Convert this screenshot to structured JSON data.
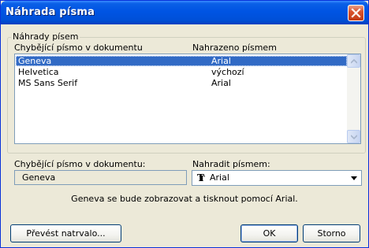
{
  "window": {
    "title": "Náhrada písma"
  },
  "group": {
    "label": "Náhrady písem"
  },
  "table": {
    "headers": [
      "Chybějící písmo v dokumentu",
      "Nahrazeno písmem"
    ],
    "rows": [
      {
        "missing": "Geneva",
        "replacement": "Arial",
        "selected": true
      },
      {
        "missing": "Helvetica",
        "replacement": "výchozí",
        "selected": false
      },
      {
        "missing": "MS Sans Serif",
        "replacement": "Arial",
        "selected": false
      }
    ]
  },
  "detail": {
    "missing_label": "Chybějící písmo v dokumentu:",
    "missing_value": "Geneva",
    "replace_label": "Nahradit písmem:",
    "replace_value": "Arial",
    "replace_icon": "truetype-icon",
    "status": "Geneva se bude zobrazovat a tisknout pomocí Arial."
  },
  "buttons": {
    "convert": "Převést natrvalo...",
    "ok": "OK",
    "cancel": "Storno"
  }
}
